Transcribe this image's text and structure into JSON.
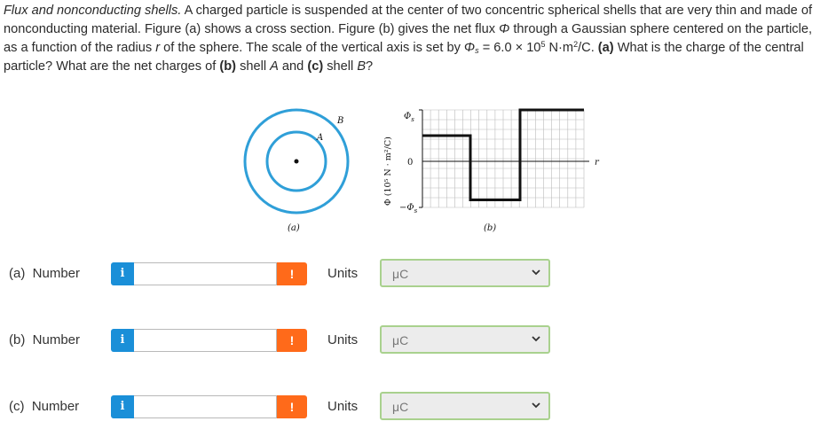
{
  "problem": {
    "title": "Flux and nonconducting shells.",
    "text_1": " A charged particle is suspended at the center of two concentric spherical shells that are very thin and made of nonconducting material. Figure (a) shows a cross section. Figure (b) gives the net flux ",
    "phi": "Φ",
    "text_2": " through a Gaussian sphere centered on the particle, as a function of the radius ",
    "r": "r",
    "text_3": " of the sphere. The scale of the vertical axis is set by ",
    "phi_s_sym": "Φ",
    "phi_s_sub": "s",
    "text_4": " = 6.0 × 10",
    "exp": "5",
    "text_5": " N·m",
    "sq": "2",
    "text_6": "/C. ",
    "a_marker": "(a)",
    "text_7": " What is the charge of the central particle? What are the net charges of ",
    "b_marker": "(b)",
    "text_8": " shell ",
    "shell_a": "A",
    "text_9": " and ",
    "c_marker": "(c)",
    "text_10": " shell ",
    "shell_b": "B",
    "text_11": "?"
  },
  "figure": {
    "shell_a_label": "A",
    "shell_b_label": "B",
    "caption_a": "(a)",
    "caption_b": "(b)",
    "y_axis_label": "Φ (10⁵ N · m²/C)",
    "tick_top": "Φs",
    "tick_zero": "0",
    "tick_bottom": "−Φs",
    "x_axis_label": "r",
    "shell_color": "#2f9fd8",
    "flux_steps_in_phi_s": [
      0.5,
      -0.75,
      1.0
    ]
  },
  "rows": [
    {
      "label": "(a)  Number",
      "info": "i",
      "warn": "!",
      "units_label": "Units",
      "unit_value": "μC"
    },
    {
      "label": "(b)  Number",
      "info": "i",
      "warn": "!",
      "units_label": "Units",
      "unit_value": "μC"
    },
    {
      "label": "(c)  Number",
      "info": "i",
      "warn": "!",
      "units_label": "Units",
      "unit_value": "μC"
    }
  ],
  "colors": {
    "info_blue": "#1a8fd8",
    "warn_orange": "#ff6a1a",
    "select_border": "#a9d18e"
  }
}
